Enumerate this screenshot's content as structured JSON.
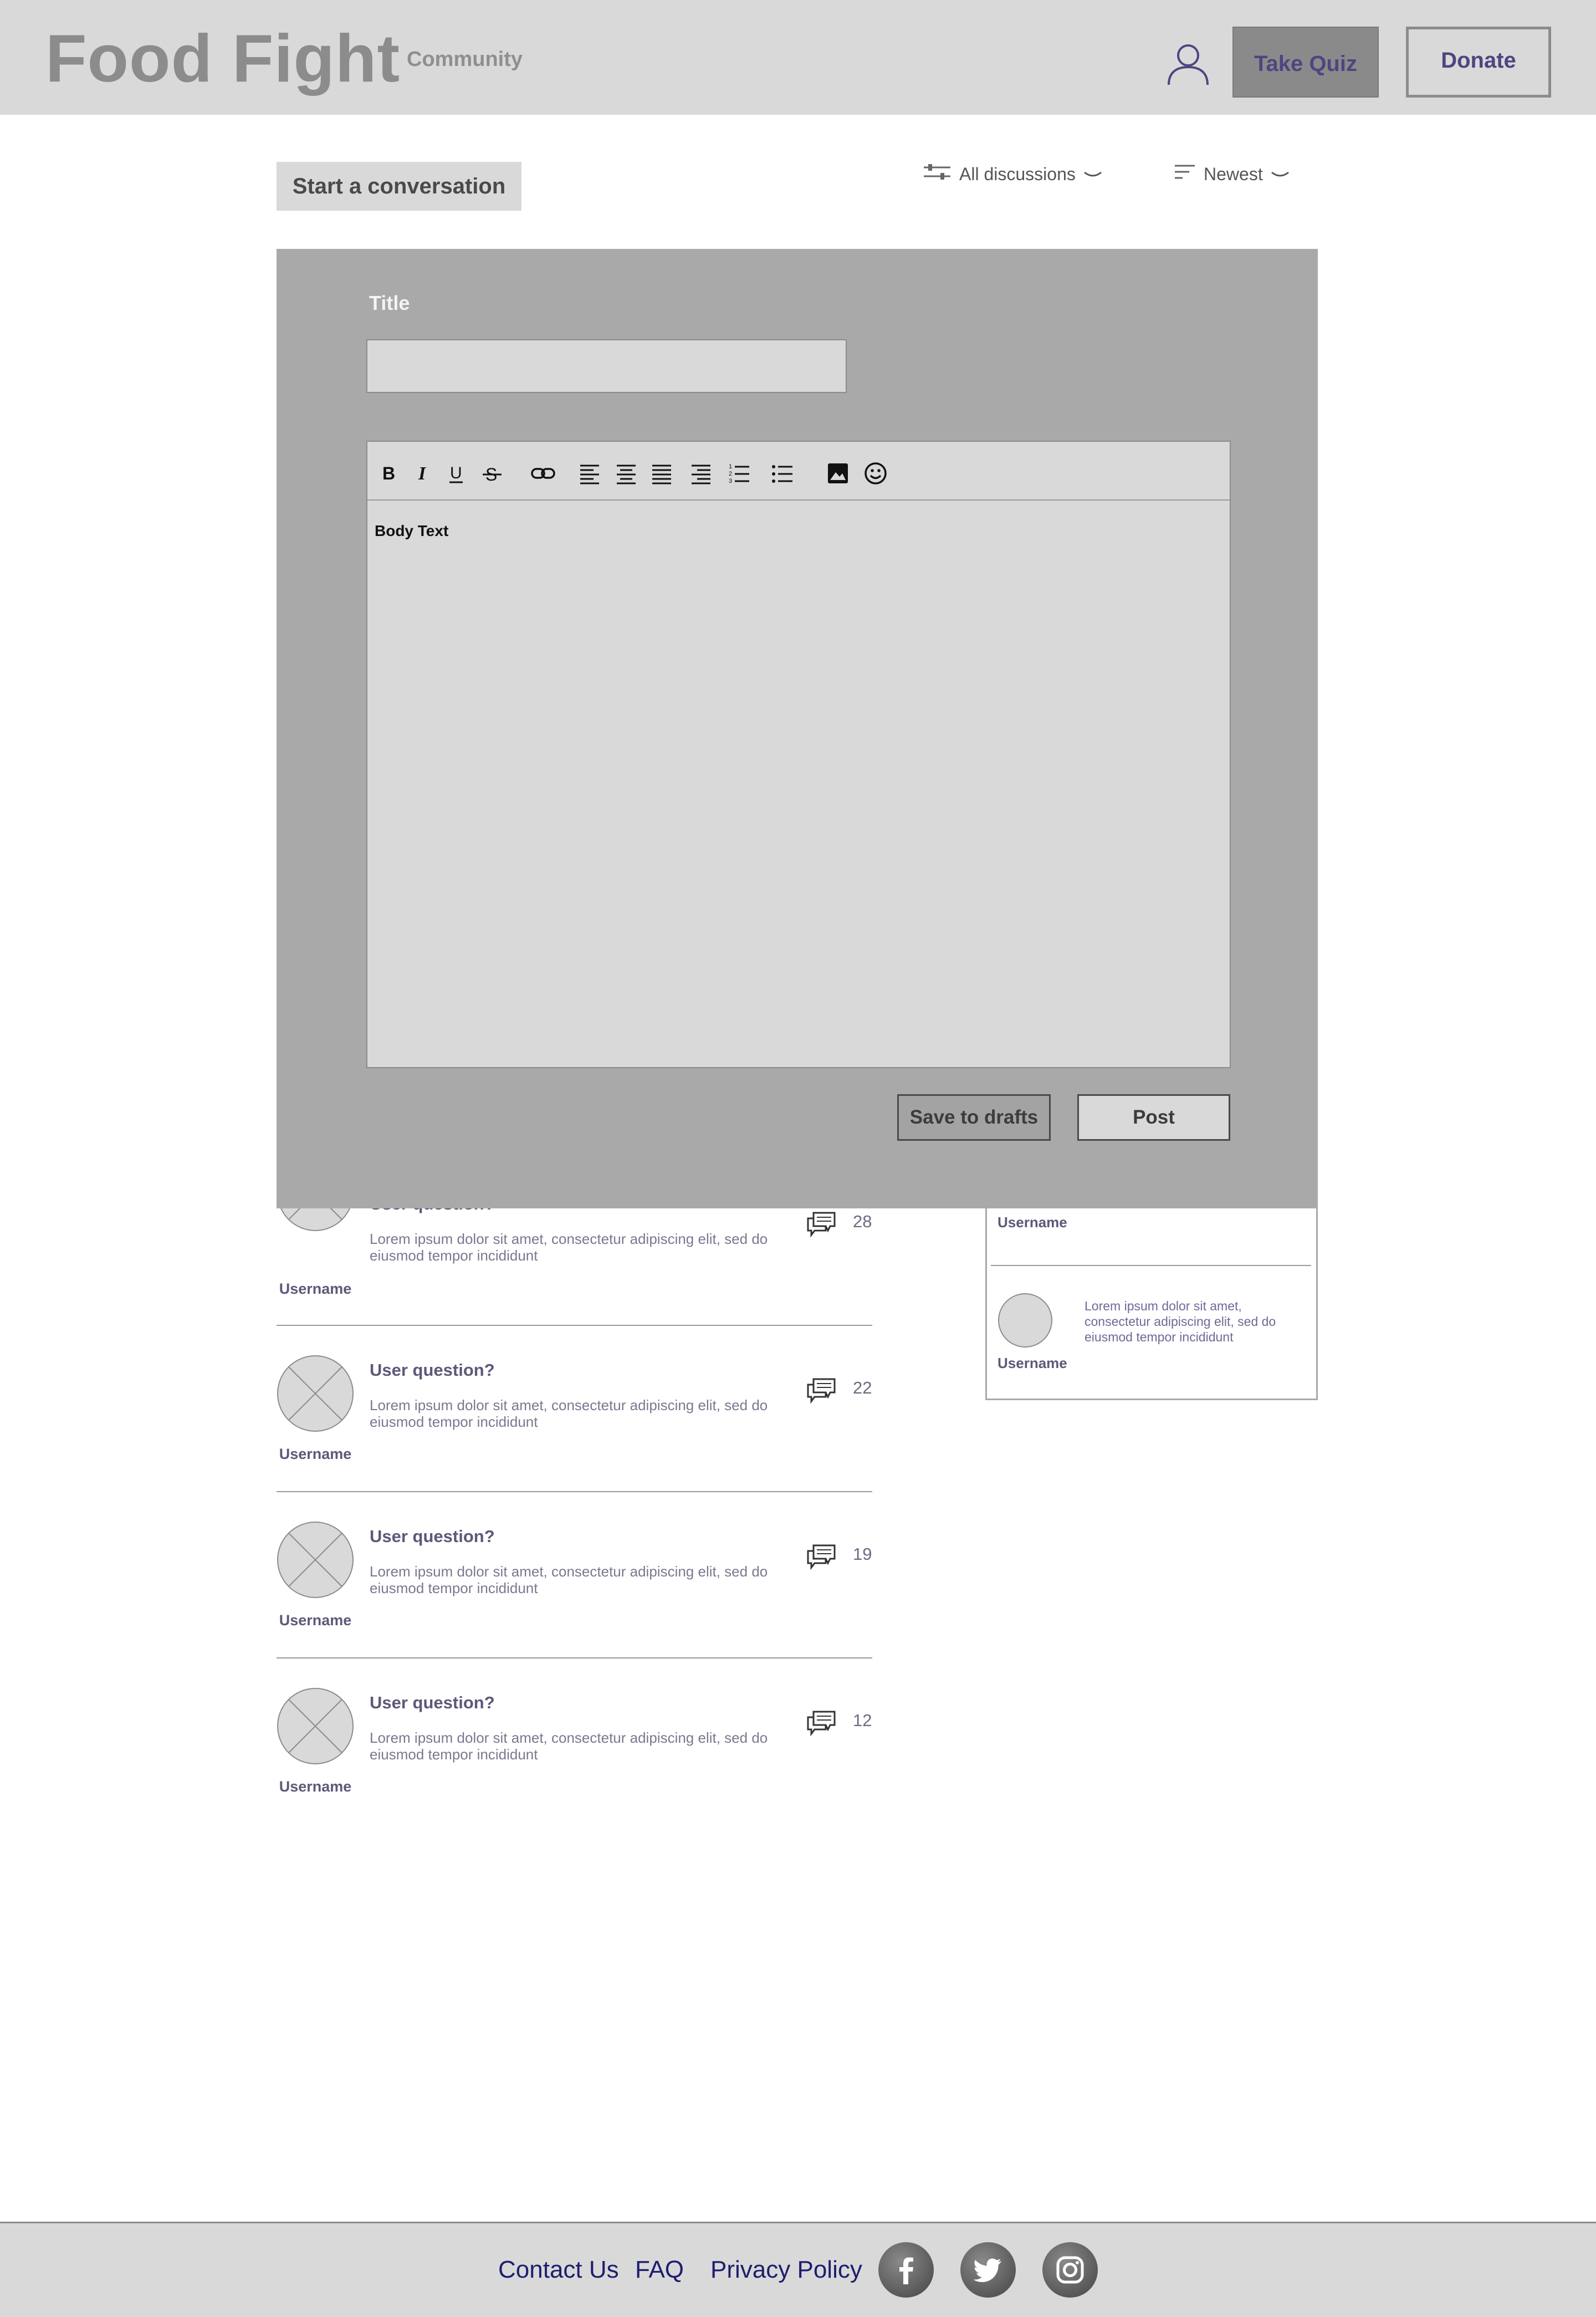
{
  "header": {
    "brand": "Food Fight",
    "section": "Community",
    "quiz_label": "Take Quiz",
    "donate_label": "Donate"
  },
  "toolbar": {
    "start_label": "Start a conversation",
    "filter_label": "All discussions",
    "sort_label": "Newest"
  },
  "discussions": [
    {
      "title": "User question?",
      "excerpt": "Lorem ipsum dolor sit amet, consectetur adipiscing elit, sed do eiusmod tempor incididunt",
      "username": "Username",
      "count": "28"
    },
    {
      "title": "User question?",
      "excerpt": "Lorem ipsum dolor sit amet, consectetur adipiscing elit, sed do eiusmod tempor incididunt",
      "username": "Username",
      "count": "22"
    },
    {
      "title": "User question?",
      "excerpt": "Lorem ipsum dolor sit amet, consectetur adipiscing elit, sed do eiusmod tempor incididunt",
      "username": "Username",
      "count": "19"
    },
    {
      "title": "User question?",
      "excerpt": "Lorem ipsum dolor sit amet, consectetur adipiscing elit, sed do eiusmod tempor incididunt",
      "username": "Username",
      "count": "12"
    }
  ],
  "side_panel": {
    "items": [
      {
        "username": "Username"
      },
      {
        "username": "Username",
        "excerpt": "Lorem ipsum dolor sit amet, consectetur adipiscing elit, sed do eiusmod tempor incididunt"
      }
    ]
  },
  "modal": {
    "title_label": "Title",
    "title_value": "",
    "body_text": "Body Text",
    "drafts_label": "Save to drafts",
    "post_label": "Post"
  },
  "footer": {
    "contact_label": "Contact Us",
    "faq_label": "FAQ",
    "privacy_label": "Privacy Policy",
    "social_icons": [
      "facebook-icon",
      "twitter-icon",
      "instagram-icon"
    ]
  },
  "colors": {
    "header_bg": "#d9d9d9",
    "modal_bg": "#a9a9a9",
    "accent_text": "#4d4680",
    "footer_link": "#1f1d6e"
  }
}
